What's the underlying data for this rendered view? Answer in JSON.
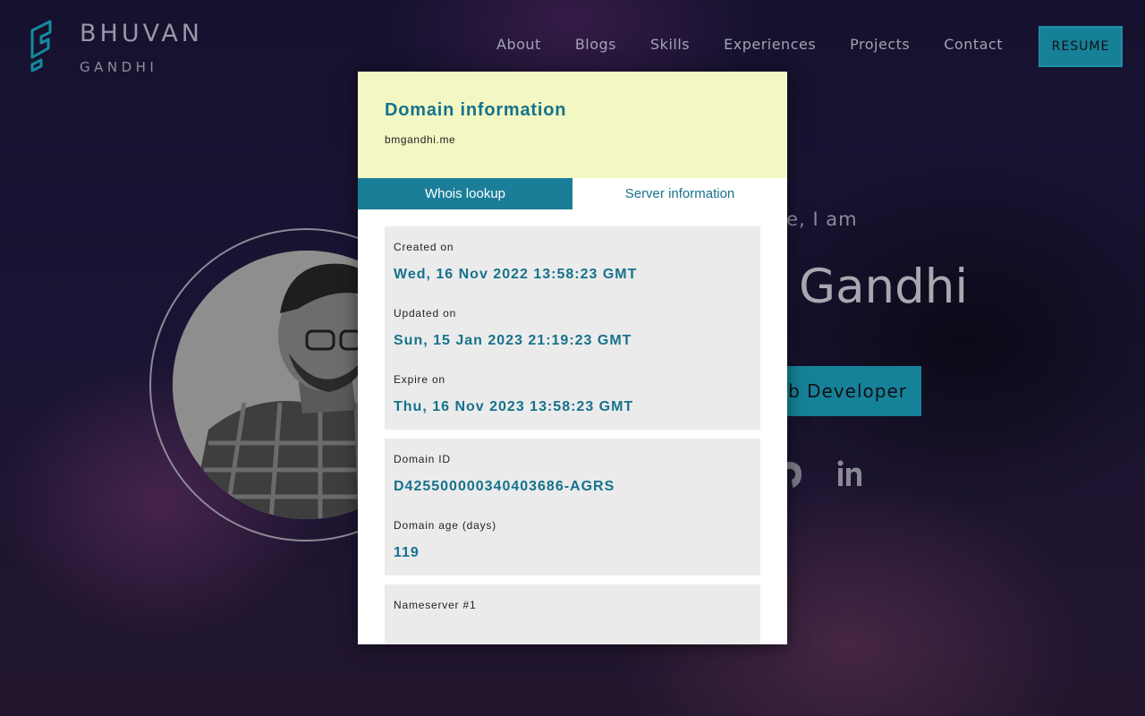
{
  "header": {
    "brand_first": "BHUVAN",
    "brand_last": "GANDHI",
    "logo_icon": "hexagon-g-logo-icon",
    "nav": [
      "About",
      "Blogs",
      "Skills",
      "Experiences",
      "Projects",
      "Contact"
    ],
    "resume_label": "RESUME"
  },
  "hero": {
    "greeting": "re, I am",
    "name": "Gandhi",
    "role": "eb Developer",
    "social_icons": [
      "github-icon",
      "linkedin-icon"
    ]
  },
  "popup": {
    "title": "Domain information",
    "domain": "bmgandhi.me",
    "tabs": {
      "active": "Whois lookup",
      "inactive": "Server information"
    },
    "card1": {
      "created_label": "Created on",
      "created_value": "Wed, 16 Nov 2022 13:58:23 GMT",
      "updated_label": "Updated on",
      "updated_value": "Sun, 15 Jan 2023 21:19:23 GMT",
      "expire_label": "Expire on",
      "expire_value": "Thu, 16 Nov 2023 13:58:23 GMT"
    },
    "card2": {
      "id_label": "Domain ID",
      "id_value": "D425500000340403686-AGRS",
      "age_label": "Domain age (days)",
      "age_value": "119"
    },
    "card3": {
      "ns_label": "Nameserver #1"
    }
  },
  "colors": {
    "accent": "#16829a",
    "popup_header_bg": "#f3f7c3",
    "popup_value": "#16728c",
    "card_bg": "#ebebeb"
  }
}
